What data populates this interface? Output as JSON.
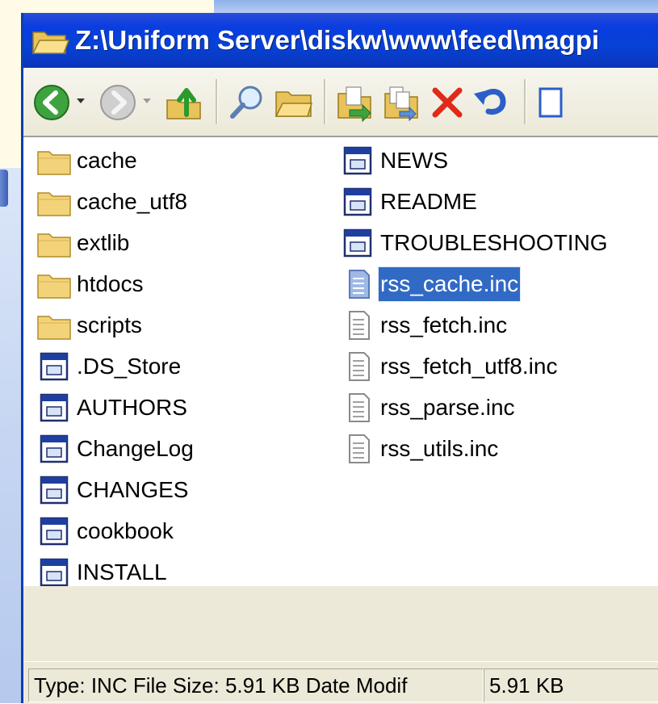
{
  "window": {
    "title": "Z:\\Uniform Server\\diskw\\www\\feed\\magpi",
    "accent_color": "#0a3de0"
  },
  "toolbar": {
    "buttons": [
      {
        "name": "back-button",
        "icon": "back-arrow-icon"
      },
      {
        "name": "back-dropdown",
        "icon": "chevron-down-icon"
      },
      {
        "name": "forward-button",
        "icon": "forward-arrow-icon"
      },
      {
        "name": "forward-dropdown",
        "icon": "chevron-down-icon"
      },
      {
        "name": "up-folder-button",
        "icon": "up-folder-icon"
      },
      {
        "name": "search-button",
        "icon": "search-icon"
      },
      {
        "name": "folders-button",
        "icon": "folders-icon"
      },
      {
        "name": "move-to-button",
        "icon": "move-to-icon"
      },
      {
        "name": "copy-to-button",
        "icon": "copy-to-icon"
      },
      {
        "name": "delete-button",
        "icon": "delete-icon"
      },
      {
        "name": "undo-button",
        "icon": "undo-icon"
      }
    ]
  },
  "files": {
    "column1": [
      {
        "label": "cache",
        "type": "folder"
      },
      {
        "label": "cache_utf8",
        "type": "folder"
      },
      {
        "label": "extlib",
        "type": "folder"
      },
      {
        "label": "htdocs",
        "type": "folder"
      },
      {
        "label": "scripts",
        "type": "folder"
      },
      {
        "label": ".DS_Store",
        "type": "app-file"
      },
      {
        "label": "AUTHORS",
        "type": "app-file"
      },
      {
        "label": "ChangeLog",
        "type": "app-file"
      },
      {
        "label": "CHANGES",
        "type": "app-file"
      },
      {
        "label": "cookbook",
        "type": "app-file"
      },
      {
        "label": "INSTALL",
        "type": "app-file"
      }
    ],
    "column2": [
      {
        "label": "NEWS",
        "type": "app-file"
      },
      {
        "label": "README",
        "type": "app-file"
      },
      {
        "label": "TROUBLESHOOTING",
        "type": "app-file"
      },
      {
        "label": "rss_cache.inc",
        "type": "text-file",
        "selected": true
      },
      {
        "label": "rss_fetch.inc",
        "type": "text-file"
      },
      {
        "label": "rss_fetch_utf8.inc",
        "type": "text-file"
      },
      {
        "label": "rss_parse.inc",
        "type": "text-file"
      },
      {
        "label": "rss_utils.inc",
        "type": "text-file"
      }
    ]
  },
  "status": {
    "details": "Type: INC File Size: 5.91 KB Date Modif",
    "size": "5.91 KB"
  }
}
